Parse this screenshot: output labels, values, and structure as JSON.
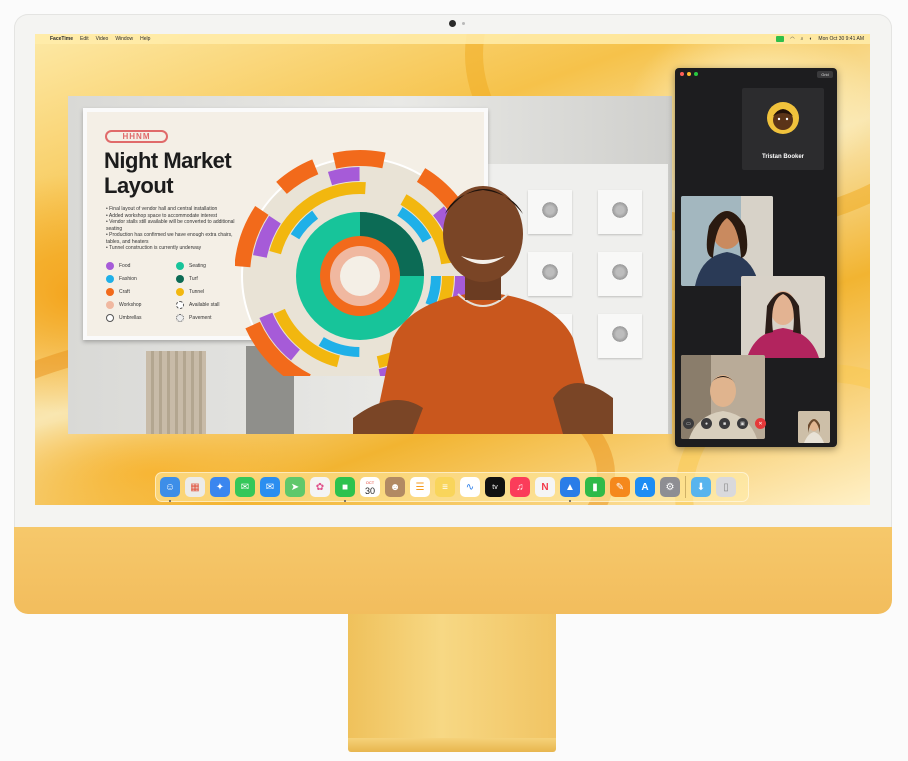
{
  "menubar": {
    "app": "FaceTime",
    "items": [
      "Edit",
      "Video",
      "Window",
      "Help"
    ],
    "clock": "Mon Oct 30  9:41 AM"
  },
  "slide": {
    "badge": "HHNM",
    "title": "Night Market Layout",
    "bullets": [
      "Final layout of vendor hall and central installation",
      "Added workshop space to accommodate interest",
      "Vendor stalls still available will be converted to additional seating",
      "Production has confirmed we have enough extra chairs, tables, and heaters",
      "Tunnel construction is currently underway"
    ],
    "legend": [
      {
        "label": "Food",
        "color": "#a65bd8"
      },
      {
        "label": "Seating",
        "color": "#17c49a"
      },
      {
        "label": "Fashion",
        "color": "#1fb0e8"
      },
      {
        "label": "Turf",
        "color": "#0c6b55"
      },
      {
        "label": "Craft",
        "color": "#f26a1b"
      },
      {
        "label": "Tunnel",
        "color": "#f2b70f"
      },
      {
        "label": "Workshop",
        "color": "#f0b8a0"
      },
      {
        "label": "Available stall",
        "color": "#ffffff"
      },
      {
        "label": "Umbrellas",
        "color": "#ffffff"
      },
      {
        "label": "Pavement",
        "color": "#ffffff"
      }
    ]
  },
  "facetime": {
    "grid_label": "Grid",
    "featured_name": "Tristan Booker",
    "controls": [
      "sidebar-toggle",
      "mute",
      "camera",
      "share-screen",
      "end-call"
    ]
  },
  "dock": {
    "apps": [
      {
        "name": "finder",
        "glyph": "☺",
        "bg": "#3d8ee8",
        "running": true
      },
      {
        "name": "launchpad",
        "glyph": "▦",
        "bg": "#ecebe8",
        "running": false
      },
      {
        "name": "safari",
        "glyph": "✦",
        "bg": "#3a86ef",
        "running": false
      },
      {
        "name": "messages",
        "glyph": "✉",
        "bg": "#34c759",
        "running": false
      },
      {
        "name": "mail",
        "glyph": "✉",
        "bg": "#2b8ef0",
        "running": false
      },
      {
        "name": "maps",
        "glyph": "➤",
        "bg": "#5fc86b",
        "running": false
      },
      {
        "name": "photos",
        "glyph": "✿",
        "bg": "#f4f4f4",
        "running": false
      },
      {
        "name": "facetime",
        "glyph": "■",
        "bg": "#2ec24e",
        "running": true
      },
      {
        "name": "calendar",
        "glyph": "30",
        "bg": "#ffffff",
        "running": false
      },
      {
        "name": "contacts",
        "glyph": "☻",
        "bg": "#b28a63",
        "running": false
      },
      {
        "name": "reminders",
        "glyph": "☰",
        "bg": "#ffffff",
        "running": false
      },
      {
        "name": "notes",
        "glyph": "≡",
        "bg": "#f9d55b",
        "running": false
      },
      {
        "name": "freeform",
        "glyph": "∿",
        "bg": "#ffffff",
        "running": false
      },
      {
        "name": "tv",
        "glyph": "tv",
        "bg": "#111111",
        "running": false
      },
      {
        "name": "music",
        "glyph": "♫",
        "bg": "#fb3c5a",
        "running": false
      },
      {
        "name": "news",
        "glyph": "N",
        "bg": "#f5f5f5",
        "running": false
      },
      {
        "name": "keynote",
        "glyph": "▲",
        "bg": "#2a7de8",
        "running": true
      },
      {
        "name": "numbers",
        "glyph": "▮",
        "bg": "#2fba49",
        "running": false
      },
      {
        "name": "pages",
        "glyph": "✎",
        "bg": "#f5881c",
        "running": false
      },
      {
        "name": "app-store",
        "glyph": "A",
        "bg": "#1d8df4",
        "running": false
      },
      {
        "name": "system-settings",
        "glyph": "⚙",
        "bg": "#8e8e93",
        "running": false
      }
    ],
    "trailing": [
      {
        "name": "downloads-folder",
        "glyph": "⬇",
        "bg": "#58b4ee"
      },
      {
        "name": "trash",
        "glyph": "🗑",
        "bg": "#d9d9dc"
      }
    ],
    "calendar_month": "OCT",
    "calendar_day": "30"
  }
}
